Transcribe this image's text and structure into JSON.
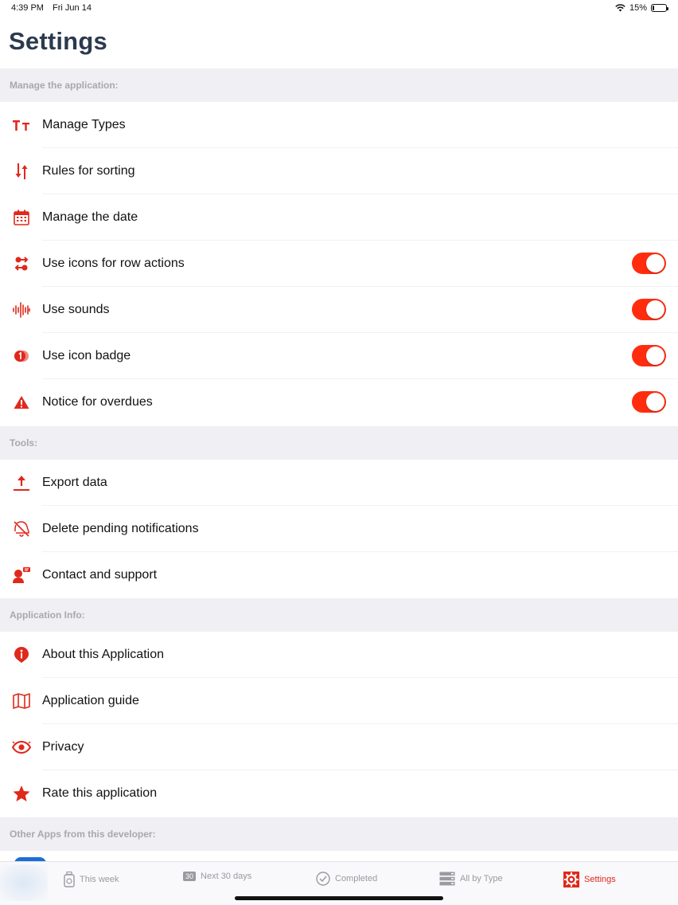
{
  "status": {
    "time": "4:39 PM",
    "date": "Fri Jun 14",
    "battery": "15%",
    "battery_level": 0.15
  },
  "title": "Settings",
  "sections": {
    "manage": "Manage the application:",
    "tools": "Tools:",
    "info": "Application Info:",
    "other": "Other Apps from this developer:"
  },
  "rows": {
    "manage_types": "Manage Types",
    "rules_sorting": "Rules for sorting",
    "manage_date": "Manage the date",
    "row_actions": "Use icons for row actions",
    "sounds": "Use sounds",
    "badge": "Use icon badge",
    "overdues": "Notice for overdues",
    "export": "Export data",
    "delete_notifications": "Delete pending notifications",
    "contact": "Contact and support",
    "about": "About this Application",
    "guide": "Application guide",
    "privacy": "Privacy",
    "rate": "Rate this application"
  },
  "toggles": {
    "row_actions": true,
    "sounds": true,
    "badge": true,
    "overdues": true
  },
  "tabs": {
    "this_week": "This week",
    "next30_badge": "30",
    "next30": "Next 30 days",
    "completed": "Completed",
    "all_by_type": "All by Type",
    "settings": "Settings"
  },
  "colors": {
    "accent": "#e0281b",
    "toggle_on": "#ff2d0e",
    "title": "#2c3a4e",
    "section_bg": "#efeff4"
  }
}
